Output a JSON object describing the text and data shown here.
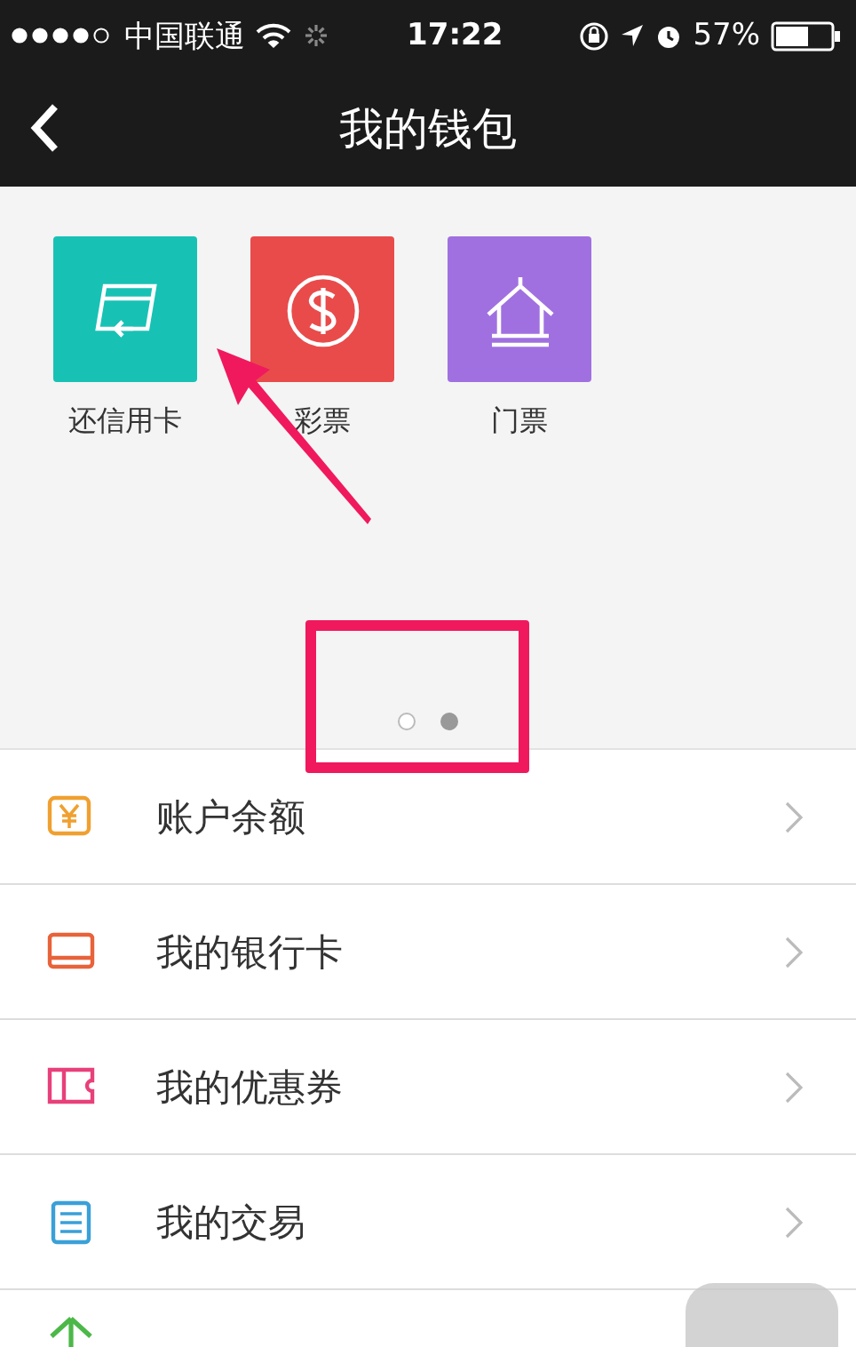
{
  "status_bar": {
    "carrier": "中国联通",
    "time": "17:22",
    "battery": "57%"
  },
  "nav_bar": {
    "title": "我的钱包"
  },
  "apps": [
    {
      "label": "还信用卡",
      "color": "#17c2b5"
    },
    {
      "label": "彩票",
      "color": "#e94b4b"
    },
    {
      "label": "门票",
      "color": "#a070e0"
    }
  ],
  "pager": [
    {
      "selected": false
    },
    {
      "selected": true
    }
  ],
  "menu": [
    {
      "label": "账户余额"
    },
    {
      "label": "我的银行卡"
    },
    {
      "label": "我的优惠券"
    },
    {
      "label": "我的交易"
    }
  ]
}
